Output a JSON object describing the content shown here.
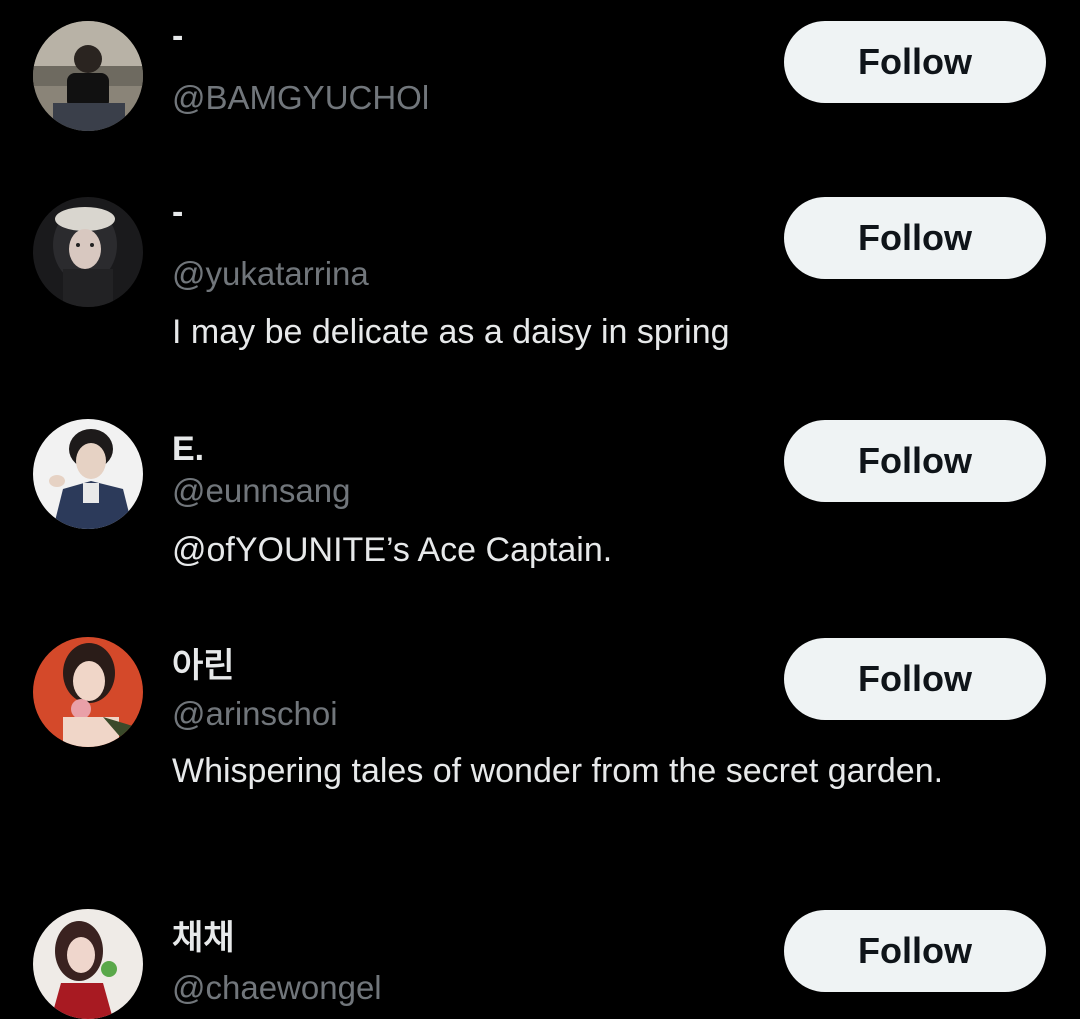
{
  "follow_suggestions": [
    {
      "name": "-",
      "handle": "@BAMGYUCHOl",
      "bio": "",
      "follow_label": "Follow",
      "avatar": "avatar-photo-man-black-shirt"
    },
    {
      "name": "-",
      "handle": "@yukatarrina",
      "bio": "I may be delicate as a daisy in spring",
      "follow_label": "Follow",
      "avatar": "avatar-photo-woman-beret"
    },
    {
      "name": "E.",
      "handle": "@eunnsang",
      "bio": "@ofYOUNITE’s Ace Captain.",
      "follow_label": "Follow",
      "avatar": "avatar-photo-man-denim-jacket"
    },
    {
      "name": "아린",
      "handle": "@arinschoi",
      "bio": "Whispering tales of wonder from the secret garden.",
      "follow_label": "Follow",
      "avatar": "avatar-photo-woman-red-background"
    },
    {
      "name": "채채",
      "handle": "@chaewongel",
      "bio": "",
      "follow_label": "Follow",
      "avatar": "avatar-photo-woman-red-dress"
    }
  ],
  "colors": {
    "background": "#000000",
    "primary_text": "#e7e9ea",
    "secondary_text": "#71767b",
    "follow_button_bg": "#eff3f4",
    "follow_button_text": "#0f1419"
  }
}
